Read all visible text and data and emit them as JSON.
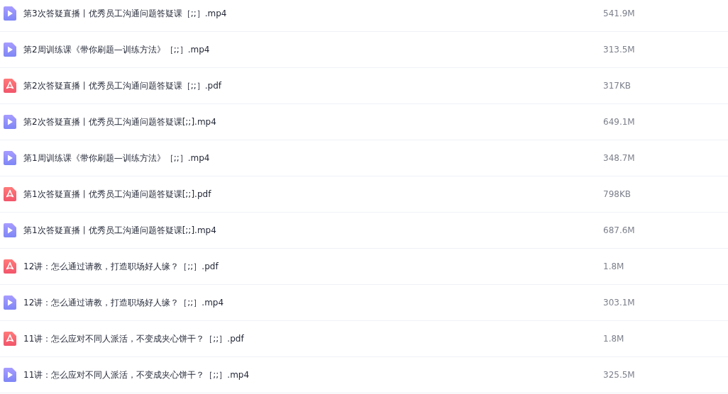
{
  "files": [
    {
      "kind": "video",
      "name": "第3次答疑直播丨优秀员工沟通问题答疑课［;;］.mp4",
      "size": "541.9M"
    },
    {
      "kind": "video",
      "name": "第2周训练课《带你刷题—训练方法》［;;］.mp4",
      "size": "313.5M"
    },
    {
      "kind": "pdf",
      "name": "第2次答疑直播丨优秀员工沟通问题答疑课［;;］.pdf",
      "size": "317KB"
    },
    {
      "kind": "video",
      "name": "第2次答疑直播丨优秀员工沟通问题答疑课[;;].mp4",
      "size": "649.1M"
    },
    {
      "kind": "video",
      "name": "第1周训练课《带你刷题—训练方法》［;;］.mp4",
      "size": "348.7M"
    },
    {
      "kind": "pdf",
      "name": "第1次答疑直播丨优秀员工沟通问题答疑课[;;].pdf",
      "size": "798KB"
    },
    {
      "kind": "video",
      "name": "第1次答疑直播丨优秀员工沟通问题答疑课[;;].mp4",
      "size": "687.6M"
    },
    {
      "kind": "pdf",
      "name": "12讲：怎么通过请教，打造职场好人缘？［;;］.pdf",
      "size": "1.8M"
    },
    {
      "kind": "video",
      "name": "12讲：怎么通过请教，打造职场好人缘？［;;］.mp4",
      "size": "303.1M"
    },
    {
      "kind": "pdf",
      "name": "11讲：怎么应对不同人派活，不变成夹心饼干？［;;］.pdf",
      "size": "1.8M"
    },
    {
      "kind": "video",
      "name": "11讲：怎么应对不同人派活，不变成夹心饼干？［;;］.mp4",
      "size": "325.5M"
    }
  ]
}
